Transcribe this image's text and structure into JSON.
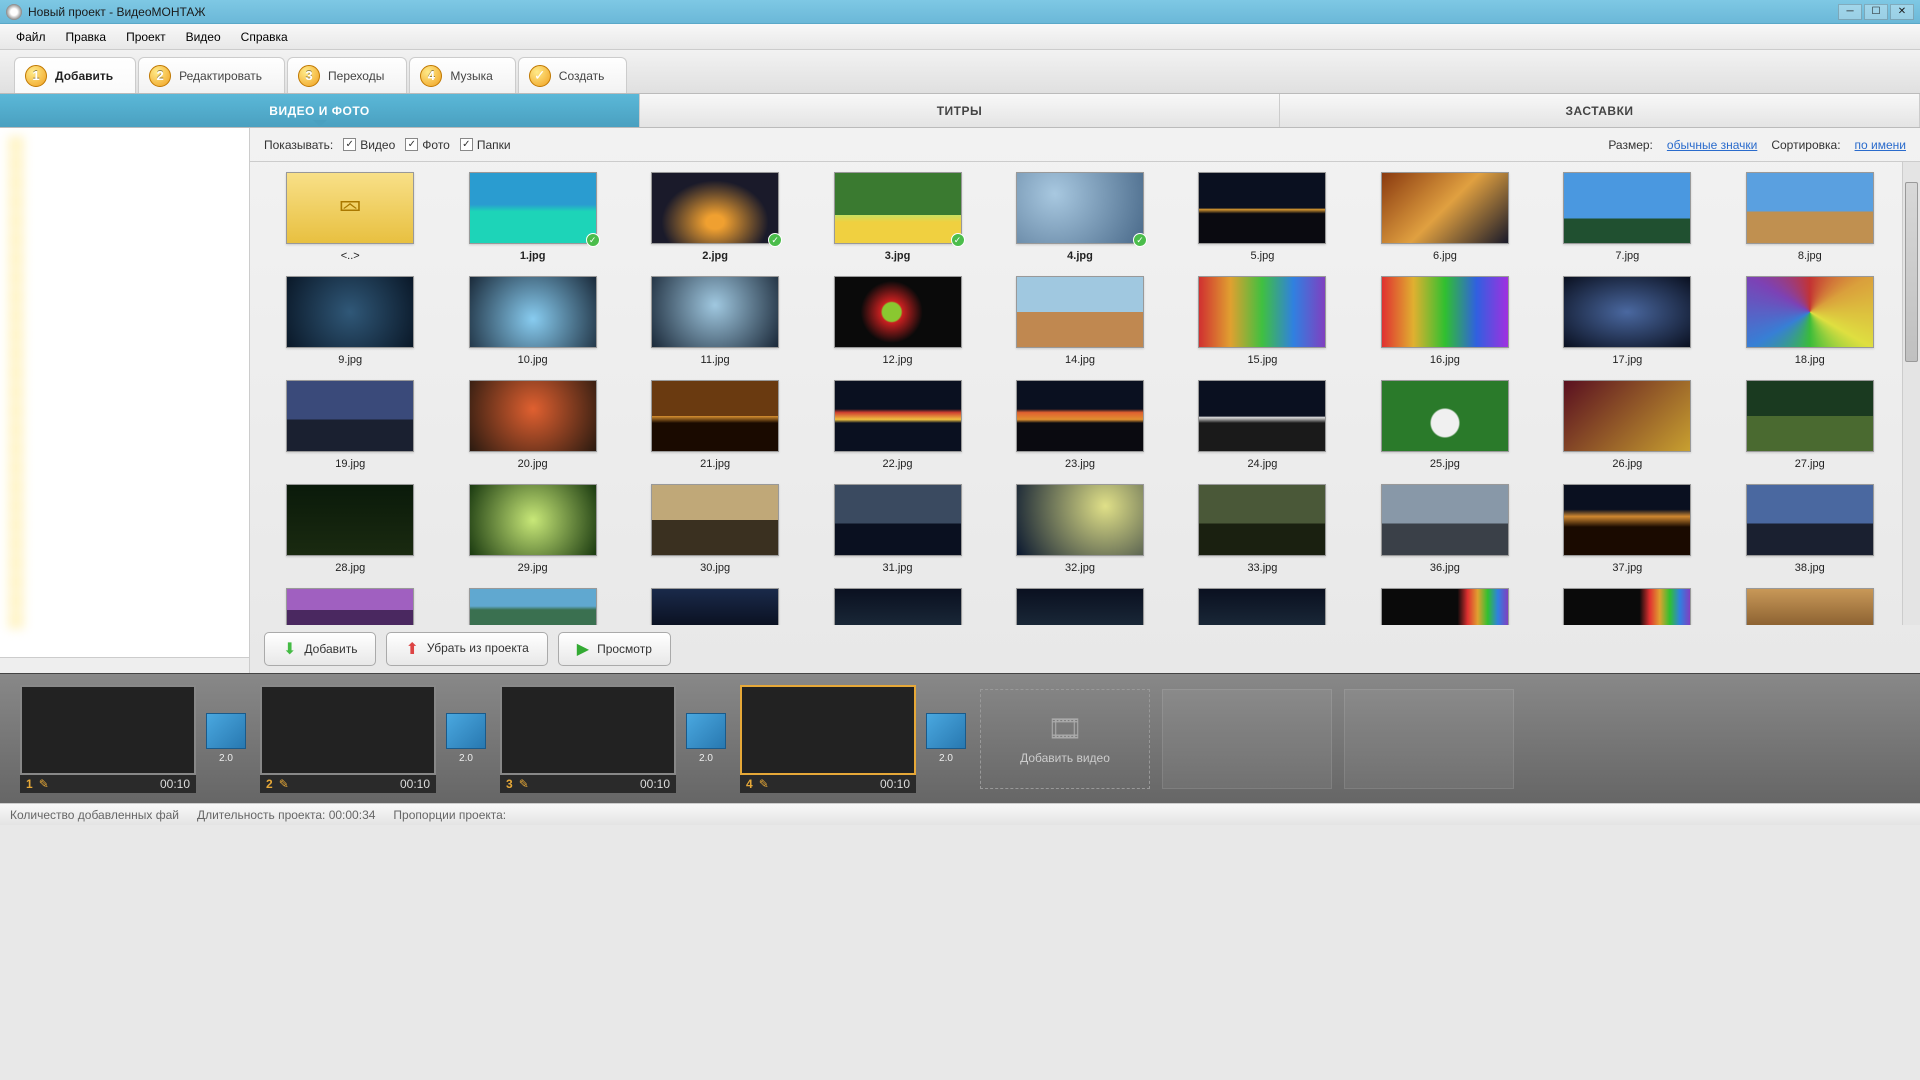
{
  "title": "Новый проект - ВидеоМОНТАЖ",
  "menu": [
    "Файл",
    "Правка",
    "Проект",
    "Видео",
    "Справка"
  ],
  "wizard": [
    {
      "num": "1",
      "label": "Добавить",
      "active": true
    },
    {
      "num": "2",
      "label": "Редактировать"
    },
    {
      "num": "3",
      "label": "Переходы"
    },
    {
      "num": "4",
      "label": "Музыка"
    },
    {
      "check": true,
      "label": "Создать"
    }
  ],
  "subtabs": [
    {
      "label": "ВИДЕО И ФОТО",
      "active": true
    },
    {
      "label": "ТИТРЫ"
    },
    {
      "label": "ЗАСТАВКИ"
    }
  ],
  "filter": {
    "show_label": "Показывать:",
    "video": "Видео",
    "photo": "Фото",
    "folders": "Папки",
    "size_label": "Размер:",
    "size_value": "обычные значки",
    "sort_label": "Сортировка:",
    "sort_value": "по имени"
  },
  "items": [
    {
      "label": "<..>",
      "folder": true
    },
    {
      "label": "1.jpg",
      "cls": "t1",
      "sel": true,
      "badge": true
    },
    {
      "label": "2.jpg",
      "cls": "t2",
      "sel": true,
      "badge": true
    },
    {
      "label": "3.jpg",
      "cls": "t3",
      "sel": true,
      "badge": true
    },
    {
      "label": "4.jpg",
      "cls": "t4",
      "sel": true,
      "badge": true
    },
    {
      "label": "5.jpg",
      "cls": "t5"
    },
    {
      "label": "6.jpg",
      "cls": "t6"
    },
    {
      "label": "7.jpg",
      "cls": "t7"
    },
    {
      "label": "8.jpg",
      "cls": "t8"
    },
    {
      "label": "9.jpg",
      "cls": "t9"
    },
    {
      "label": "10.jpg",
      "cls": "t10"
    },
    {
      "label": "11.jpg",
      "cls": "t11"
    },
    {
      "label": "12.jpg",
      "cls": "t12"
    },
    {
      "label": "14.jpg",
      "cls": "t13"
    },
    {
      "label": "15.jpg",
      "cls": "t14"
    },
    {
      "label": "16.jpg",
      "cls": "t15"
    },
    {
      "label": "17.jpg",
      "cls": "t16"
    },
    {
      "label": "18.jpg",
      "cls": "t17"
    },
    {
      "label": "19.jpg",
      "cls": "t18"
    },
    {
      "label": "20.jpg",
      "cls": "t19"
    },
    {
      "label": "21.jpg",
      "cls": "t20"
    },
    {
      "label": "22.jpg",
      "cls": "t21"
    },
    {
      "label": "23.jpg",
      "cls": "t22"
    },
    {
      "label": "24.jpg",
      "cls": "t23"
    },
    {
      "label": "25.jpg",
      "cls": "t24"
    },
    {
      "label": "26.jpg",
      "cls": "t25"
    },
    {
      "label": "27.jpg",
      "cls": "t26"
    },
    {
      "label": "28.jpg",
      "cls": "t27"
    },
    {
      "label": "29.jpg",
      "cls": "t28"
    },
    {
      "label": "30.jpg",
      "cls": "t29"
    },
    {
      "label": "31.jpg",
      "cls": "t30"
    },
    {
      "label": "32.jpg",
      "cls": "t31"
    },
    {
      "label": "33.jpg",
      "cls": "t32"
    },
    {
      "label": "36.jpg",
      "cls": "t33"
    },
    {
      "label": "37.jpg",
      "cls": "t34"
    },
    {
      "label": "38.jpg",
      "cls": "t35"
    },
    {
      "label": "",
      "cls": "t36",
      "partial": true
    },
    {
      "label": "",
      "cls": "t37",
      "partial": true
    },
    {
      "label": "",
      "cls": "t38",
      "partial": true
    },
    {
      "label": "",
      "cls": "t39",
      "partial": true
    },
    {
      "label": "",
      "cls": "t39",
      "partial": true
    },
    {
      "label": "",
      "cls": "t39",
      "partial": true
    },
    {
      "label": "",
      "cls": "t40",
      "partial": true
    },
    {
      "label": "",
      "cls": "t40",
      "partial": true
    },
    {
      "label": "",
      "cls": "t41",
      "partial": true
    }
  ],
  "buttons": {
    "add": "Добавить",
    "remove": "Убрать из проекта",
    "preview": "Просмотр"
  },
  "timeline": {
    "trans": "2.0",
    "clips": [
      {
        "n": "1",
        "time": "00:10",
        "cls": "t1"
      },
      {
        "n": "2",
        "time": "00:10",
        "cls": "t2"
      },
      {
        "n": "3",
        "time": "00:10",
        "cls": "t3"
      },
      {
        "n": "4",
        "time": "00:10",
        "cls": "t4",
        "sel": true
      }
    ],
    "add": "Добавить видео"
  },
  "status": {
    "count": "Количество добавленных фай",
    "duration_label": "Длительность проекта:",
    "duration": "00:00:34",
    "aspect": "Пропорции проекта:"
  }
}
